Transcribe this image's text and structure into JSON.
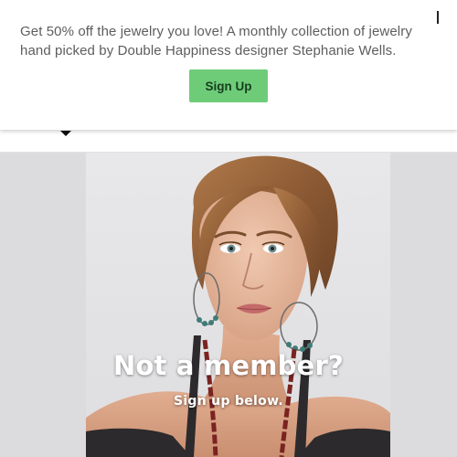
{
  "promo": {
    "message": "Get 50% off the jewelry you love! A monthly collection of jewelry hand picked by Double Happiness designer Stephanie Wells.",
    "button_label": "Sign Up",
    "close_icon": "close-icon"
  },
  "header": {
    "menu_icon": "dropdown-caret-icon"
  },
  "hero": {
    "title": "Not a member?",
    "subtitle": "Sign up below."
  },
  "colors": {
    "button": "#6ecc79",
    "button_text": "#173e1c",
    "body_text": "#5d5d5d",
    "hero_background": "#dcdcde"
  }
}
